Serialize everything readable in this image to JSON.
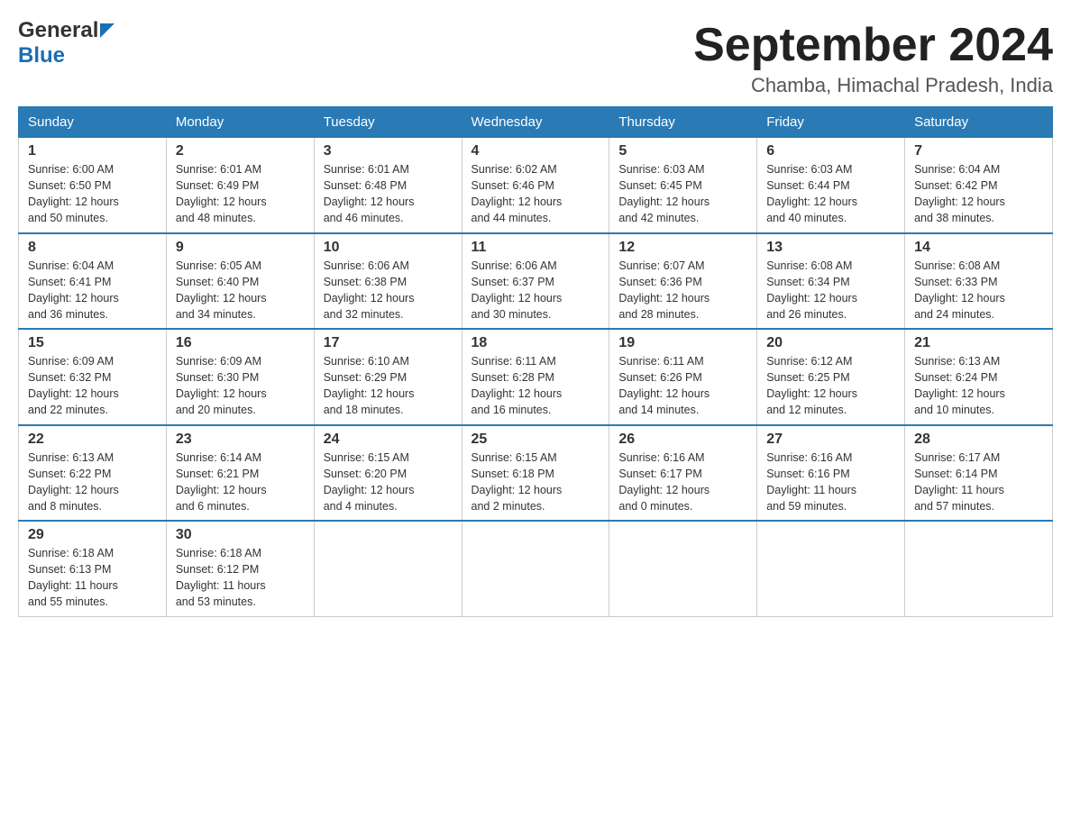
{
  "header": {
    "logo_general": "General",
    "logo_blue": "Blue",
    "month_title": "September 2024",
    "location": "Chamba, Himachal Pradesh, India"
  },
  "weekdays": [
    "Sunday",
    "Monday",
    "Tuesday",
    "Wednesday",
    "Thursday",
    "Friday",
    "Saturday"
  ],
  "weeks": [
    [
      {
        "day": "1",
        "sunrise": "6:00 AM",
        "sunset": "6:50 PM",
        "daylight": "12 hours and 50 minutes."
      },
      {
        "day": "2",
        "sunrise": "6:01 AM",
        "sunset": "6:49 PM",
        "daylight": "12 hours and 48 minutes."
      },
      {
        "day": "3",
        "sunrise": "6:01 AM",
        "sunset": "6:48 PM",
        "daylight": "12 hours and 46 minutes."
      },
      {
        "day": "4",
        "sunrise": "6:02 AM",
        "sunset": "6:46 PM",
        "daylight": "12 hours and 44 minutes."
      },
      {
        "day": "5",
        "sunrise": "6:03 AM",
        "sunset": "6:45 PM",
        "daylight": "12 hours and 42 minutes."
      },
      {
        "day": "6",
        "sunrise": "6:03 AM",
        "sunset": "6:44 PM",
        "daylight": "12 hours and 40 minutes."
      },
      {
        "day": "7",
        "sunrise": "6:04 AM",
        "sunset": "6:42 PM",
        "daylight": "12 hours and 38 minutes."
      }
    ],
    [
      {
        "day": "8",
        "sunrise": "6:04 AM",
        "sunset": "6:41 PM",
        "daylight": "12 hours and 36 minutes."
      },
      {
        "day": "9",
        "sunrise": "6:05 AM",
        "sunset": "6:40 PM",
        "daylight": "12 hours and 34 minutes."
      },
      {
        "day": "10",
        "sunrise": "6:06 AM",
        "sunset": "6:38 PM",
        "daylight": "12 hours and 32 minutes."
      },
      {
        "day": "11",
        "sunrise": "6:06 AM",
        "sunset": "6:37 PM",
        "daylight": "12 hours and 30 minutes."
      },
      {
        "day": "12",
        "sunrise": "6:07 AM",
        "sunset": "6:36 PM",
        "daylight": "12 hours and 28 minutes."
      },
      {
        "day": "13",
        "sunrise": "6:08 AM",
        "sunset": "6:34 PM",
        "daylight": "12 hours and 26 minutes."
      },
      {
        "day": "14",
        "sunrise": "6:08 AM",
        "sunset": "6:33 PM",
        "daylight": "12 hours and 24 minutes."
      }
    ],
    [
      {
        "day": "15",
        "sunrise": "6:09 AM",
        "sunset": "6:32 PM",
        "daylight": "12 hours and 22 minutes."
      },
      {
        "day": "16",
        "sunrise": "6:09 AM",
        "sunset": "6:30 PM",
        "daylight": "12 hours and 20 minutes."
      },
      {
        "day": "17",
        "sunrise": "6:10 AM",
        "sunset": "6:29 PM",
        "daylight": "12 hours and 18 minutes."
      },
      {
        "day": "18",
        "sunrise": "6:11 AM",
        "sunset": "6:28 PM",
        "daylight": "12 hours and 16 minutes."
      },
      {
        "day": "19",
        "sunrise": "6:11 AM",
        "sunset": "6:26 PM",
        "daylight": "12 hours and 14 minutes."
      },
      {
        "day": "20",
        "sunrise": "6:12 AM",
        "sunset": "6:25 PM",
        "daylight": "12 hours and 12 minutes."
      },
      {
        "day": "21",
        "sunrise": "6:13 AM",
        "sunset": "6:24 PM",
        "daylight": "12 hours and 10 minutes."
      }
    ],
    [
      {
        "day": "22",
        "sunrise": "6:13 AM",
        "sunset": "6:22 PM",
        "daylight": "12 hours and 8 minutes."
      },
      {
        "day": "23",
        "sunrise": "6:14 AM",
        "sunset": "6:21 PM",
        "daylight": "12 hours and 6 minutes."
      },
      {
        "day": "24",
        "sunrise": "6:15 AM",
        "sunset": "6:20 PM",
        "daylight": "12 hours and 4 minutes."
      },
      {
        "day": "25",
        "sunrise": "6:15 AM",
        "sunset": "6:18 PM",
        "daylight": "12 hours and 2 minutes."
      },
      {
        "day": "26",
        "sunrise": "6:16 AM",
        "sunset": "6:17 PM",
        "daylight": "12 hours and 0 minutes."
      },
      {
        "day": "27",
        "sunrise": "6:16 AM",
        "sunset": "6:16 PM",
        "daylight": "11 hours and 59 minutes."
      },
      {
        "day": "28",
        "sunrise": "6:17 AM",
        "sunset": "6:14 PM",
        "daylight": "11 hours and 57 minutes."
      }
    ],
    [
      {
        "day": "29",
        "sunrise": "6:18 AM",
        "sunset": "6:13 PM",
        "daylight": "11 hours and 55 minutes."
      },
      {
        "day": "30",
        "sunrise": "6:18 AM",
        "sunset": "6:12 PM",
        "daylight": "11 hours and 53 minutes."
      },
      null,
      null,
      null,
      null,
      null
    ]
  ],
  "labels": {
    "sunrise": "Sunrise:",
    "sunset": "Sunset:",
    "daylight": "Daylight:"
  }
}
